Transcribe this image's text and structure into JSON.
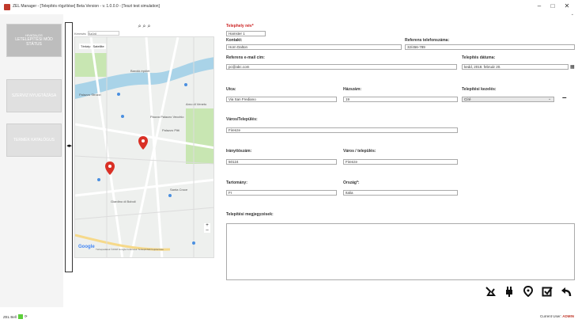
{
  "window": {
    "title": "ZEL Manager - [Telepítés rögzítése] Beta Version - v. 1.0.0.0 - [Teszt test simulation]",
    "minimize": "–",
    "maximize": "□",
    "close": "✕",
    "sub_arrow": "⌄"
  },
  "sidebar": {
    "items": [
      {
        "small": "Hivatalos",
        "label": "LETELEPÍTÉSI MÓD STÁTUS"
      },
      {
        "small": "",
        "label": "SZERVIZ nyugtázása"
      },
      {
        "small": "",
        "label": "TERMÉK katalógus"
      }
    ]
  },
  "map": {
    "search_label": "Keresés",
    "search_value": "Szűrő",
    "layer_tabs": [
      "Térkép",
      "Satellite"
    ],
    "zoom_in": "+",
    "zoom_out": "–",
    "logo": "Google",
    "footer": "Térképadatok ©2018 Google  Feltételek  Térképhibák bejelentése",
    "labels": [
      "Barokk épület",
      "Piazza Palazzo Vecchio",
      "Palazzo Pitti",
      "Giardino di Boboli",
      "Palazzo Strozzi",
      "Arno di Veneto",
      "Santa Croce"
    ]
  },
  "form": {
    "title_label": "Telephely név*",
    "title_value": "Hamster 1",
    "contact_label": "Kontakt:",
    "contact_value": "Horn Dalton",
    "ref_phone_label": "Referens telefonszáma:",
    "ref_phone_value": "32/456-789",
    "ref_email_label": "Referens e-mail cím:",
    "ref_email_value": "pc@abc.com",
    "install_date_label": "Telepítés dátuma:",
    "install_date_value": "kedd, 2018. február 20.",
    "street_label": "Utca:",
    "street_value": "Via San Frediano",
    "house_label": "Házszám:",
    "house_value": "19",
    "install_location_label": "Telepítési kezelés:",
    "install_location_value": "Círé",
    "city_label": "Város/Település:",
    "city_value": "Firenze",
    "zip_label": "Irányítószám:",
    "zip_value": "50124",
    "town_label": "Város / település:",
    "town_value": "Firenze",
    "county_label": "Tartomány:",
    "county_value": "FI",
    "country_label": "Ország*:",
    "country_value": "Italia",
    "notes_label": "Telepítési megjegyzések:"
  },
  "actions": [
    "scan-icon",
    "plug-icon",
    "location-pin-icon",
    "check-box-icon",
    "back-arrow-icon"
  ],
  "status": {
    "left_text": "ZEL Bell",
    "right_prefix": "Current User:",
    "user": "ADMIN"
  },
  "colors": {
    "accent_red": "#cc2222",
    "status_green": "#5ccf3a",
    "water": "#a9d3e8",
    "park": "#c8e6b2"
  }
}
